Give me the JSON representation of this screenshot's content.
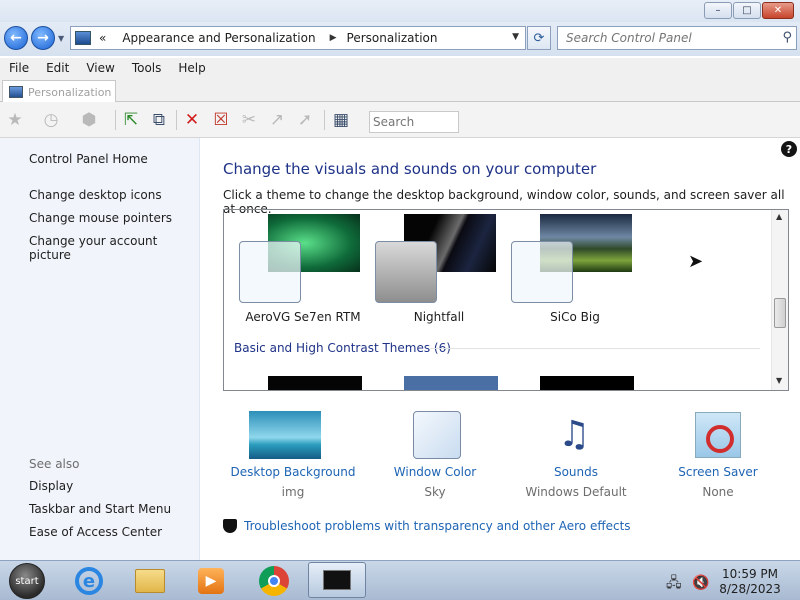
{
  "window": {
    "controls": {
      "minimize": "–",
      "maximize": "□",
      "close": "✕"
    }
  },
  "address_bar": {
    "back": "←",
    "forward": "→",
    "overflow": "«",
    "crumbs": [
      "Appearance and Personalization",
      "Personalization"
    ],
    "search_placeholder": "Search Control Panel"
  },
  "menu": [
    "File",
    "Edit",
    "View",
    "Tools",
    "Help"
  ],
  "tab": {
    "label": "Personalization"
  },
  "toolbar": {
    "search_placeholder": "Search"
  },
  "sidebar": {
    "home": "Control Panel Home",
    "links": [
      "Change desktop icons",
      "Change mouse pointers",
      "Change your account picture"
    ],
    "see_also_title": "See also",
    "see_also": [
      "Display",
      "Taskbar and Start Menu",
      "Ease of Access Center"
    ]
  },
  "main": {
    "help": "?",
    "heading": "Change the visuals and sounds on your computer",
    "subtext": "Click a theme to change the desktop background, window color, sounds, and screen saver all at once.",
    "themes": [
      {
        "name": "AeroVG Se7en RTM"
      },
      {
        "name": "Nightfall"
      },
      {
        "name": "SiCo Big"
      }
    ],
    "basic_section": "Basic and High Contrast Themes (6)",
    "settings": [
      {
        "label": "Desktop Background",
        "value": "img"
      },
      {
        "label": "Window Color",
        "value": "Sky"
      },
      {
        "label": "Sounds",
        "value": "Windows Default"
      },
      {
        "label": "Screen Saver",
        "value": "None"
      }
    ],
    "troubleshoot": "Troubleshoot problems with transparency and other Aero effects"
  },
  "taskbar": {
    "start": "start",
    "time": "10:59 PM",
    "date": "8/28/2023"
  }
}
